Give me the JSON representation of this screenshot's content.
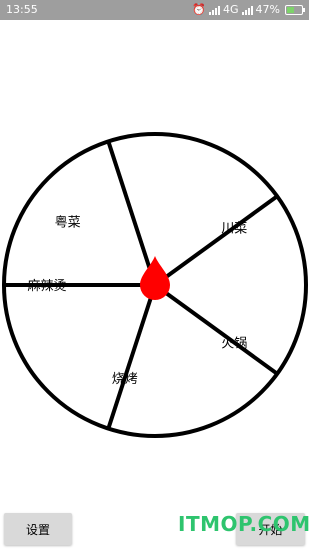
{
  "status_bar": {
    "time": "13:55",
    "network": "4G",
    "battery_percent": "47%",
    "battery_level": 0.47
  },
  "wheel": {
    "segments": [
      {
        "label": "粤菜"
      },
      {
        "label": "川菜"
      },
      {
        "label": "火锅"
      },
      {
        "label": "烧烤"
      },
      {
        "label": "麻辣烫"
      }
    ],
    "pointer_color": "#ff0000",
    "line_color": "#000000"
  },
  "buttons": {
    "settings_label": "设置",
    "start_label": "开始"
  },
  "watermark": {
    "text": "ITMOP.COM",
    "color": "#2ec46e"
  }
}
